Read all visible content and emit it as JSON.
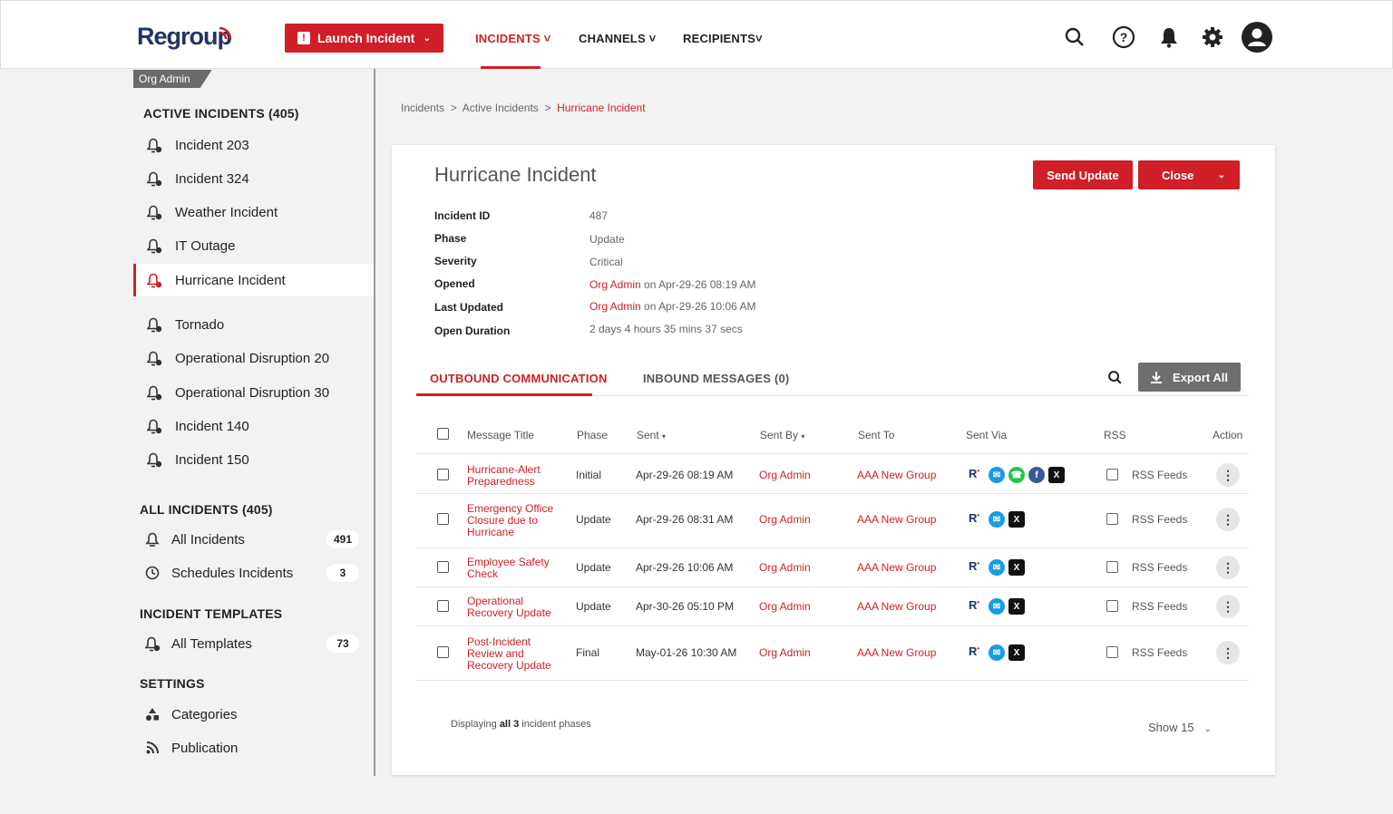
{
  "brand": {
    "name": "Regroup",
    "accent": "#d01f26",
    "navy": "#1f3566"
  },
  "topnav": {
    "launch_label": "Launch Incident",
    "items": [
      "INCIDENTS",
      "CHANNELS",
      "RECIPIENTS"
    ],
    "icons": [
      "search-icon",
      "help-icon",
      "bell-icon",
      "gear-icon",
      "user-avatar-icon"
    ]
  },
  "sidebar": {
    "org_tag": "Org Admin",
    "active_head": "ACTIVE INCIDENTS (405)",
    "active_items": [
      "Incident 203",
      "Incident 324",
      "Weather Incident",
      "IT Outage",
      "Hurricane Incident",
      "Tornado",
      "Operational Disruption 20",
      "Operational Disruption 30",
      "Incident 140",
      "Incident 150"
    ],
    "all_head": "ALL INCIDENTS (405)",
    "all_items": [
      {
        "label": "All Incidents",
        "count": "491"
      },
      {
        "label": "Schedules Incidents",
        "count": "3"
      }
    ],
    "templates_head": "INCIDENT TEMPLATES",
    "templates_items": [
      {
        "label": "All Templates",
        "count": "73"
      }
    ],
    "settings_head": "SETTINGS",
    "settings_items": [
      "Categories",
      "Publication"
    ]
  },
  "breadcrumb": {
    "items": [
      "Incidents",
      "Active Incidents"
    ],
    "current": "Hurricane Incident",
    "sep": ">"
  },
  "incident": {
    "title": "Hurricane Incident",
    "send_update": "Send Update",
    "close": "Close",
    "labels": [
      "Incident ID",
      "Phase",
      "Severity",
      "Opened",
      "Last Updated",
      "Open Duration"
    ],
    "id": "487",
    "phase": "Update",
    "severity": "Critical",
    "opened_by": "Org Admin",
    "opened_on": "on Apr-29-26 08:19 AM",
    "updated_by": "Org Admin",
    "updated_on": "on Apr-29-26 10:06 AM",
    "duration": "2 days 4 hours 35 mins 37 secs"
  },
  "tabs": {
    "outbound": "OUTBOUND COMMUNICATION",
    "inbound": "INBOUND MESSAGES (0)",
    "export": "Export All"
  },
  "table": {
    "headers": [
      "Message Title",
      "Phase",
      "Sent",
      "Sent By",
      "Sent To",
      "Sent Via",
      "RSS",
      "Action"
    ],
    "rows": [
      {
        "title": "Hurricane-Alert Preparedness",
        "phase": "Initial",
        "sent": "Apr-29-26 08:19 AM",
        "by": "Org Admin",
        "to": "AAA New Group",
        "rss": "RSS Feeds",
        "via": [
          "regroup",
          "email",
          "whatsapp",
          "facebook",
          "x"
        ]
      },
      {
        "title": "Emergency Office Closure due to Hurricane",
        "phase": "Update",
        "sent": "Apr-29-26 08:31 AM",
        "by": "Org Admin",
        "to": "AAA New Group",
        "rss": "RSS Feeds",
        "via": [
          "regroup",
          "email",
          "x"
        ]
      },
      {
        "title": "Employee Safety Check",
        "phase": "Update",
        "sent": "Apr-29-26 10:06 AM",
        "by": "Org Admin",
        "to": "AAA New Group",
        "rss": "RSS Feeds",
        "via": [
          "regroup",
          "email",
          "x"
        ]
      },
      {
        "title": "Operational Recovery Update",
        "phase": "Update",
        "sent": "Apr-30-26 05:10 PM",
        "by": "Org Admin",
        "to": "AAA New Group",
        "rss": "RSS Feeds",
        "via": [
          "regroup",
          "email",
          "x"
        ]
      },
      {
        "title": "Post-Incident Review and Recovery Update",
        "phase": "Final",
        "sent": "May-01-26 10:30 AM",
        "by": "Org Admin",
        "to": "AAA New Group",
        "rss": "RSS Feeds",
        "via": [
          "regroup",
          "email",
          "x"
        ]
      }
    ]
  },
  "footer": {
    "prefix": "Displaying",
    "bold": "all 3",
    "suffix": "incident phases",
    "show": "Show 15"
  }
}
